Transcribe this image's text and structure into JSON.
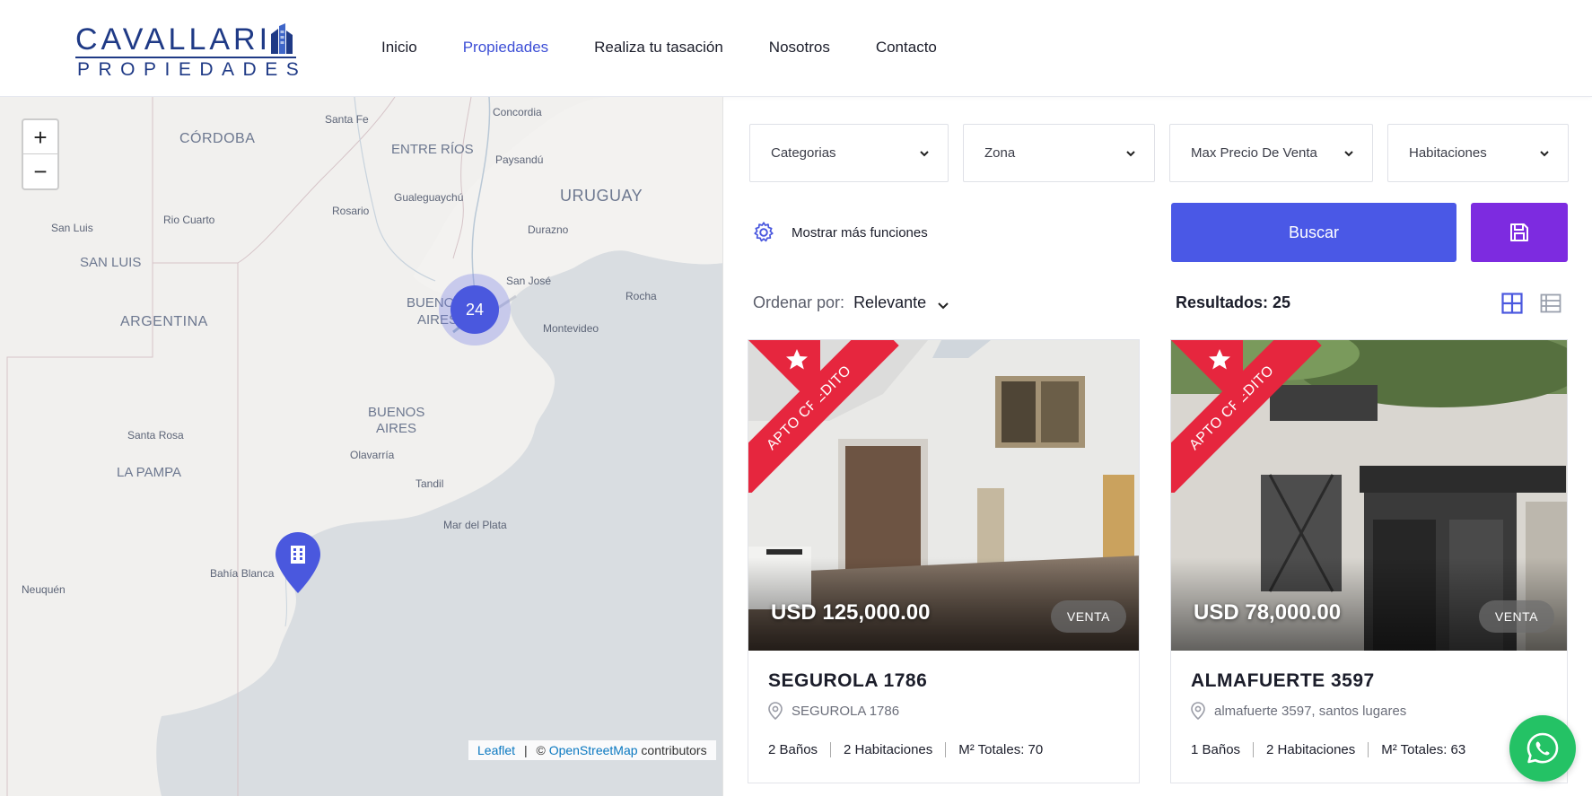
{
  "brand": {
    "logo_top": "CAVALLARI",
    "logo_bottom": "PROPIEDADES",
    "color": "#1f3a86"
  },
  "nav": {
    "items": [
      "Inicio",
      "Propiedades",
      "Realiza tu tasación",
      "Nosotros",
      "Contacto"
    ],
    "active": "Propiedades"
  },
  "map": {
    "zoom_in": "+",
    "zoom_out": "−",
    "cluster_count": "24",
    "labels": {
      "cordoba": "CÓRDOBA",
      "entre_rios": "ENTRE RÍOS",
      "uruguay": "URUGUAY",
      "san_luis_prov": "SAN LUIS",
      "argentina": "ARGENTINA",
      "buenos_aires_city_1": "BUENO",
      "buenos_aires_city_2": "AIRES",
      "buenos_aires_prov_1": "BUENOS",
      "buenos_aires_prov_2": "AIRES",
      "la_pampa": "LA PAMPA",
      "santa_fe": "Santa Fe",
      "concordia": "Concordia",
      "paysandu": "Paysandú",
      "gualeguaychu": "Gualeguaychú",
      "rosario": "Rosario",
      "san_luis": "San Luis",
      "rio_cuarto": "Rio Cuarto",
      "durazno": "Durazno",
      "san_jose": "San José",
      "rocha": "Rocha",
      "montevideo": "Montevideo",
      "santa_rosa": "Santa Rosa",
      "olavarria": "Olavarría",
      "tandil": "Tandil",
      "mar_del_plata": "Mar del Plata",
      "bahia_blanca": "Bahía Blanca",
      "neuquen": "Neuquén"
    },
    "attribution": {
      "leaflet": "Leaflet",
      "sep": "|",
      "copy": "©",
      "osm": "OpenStreetMap",
      "contributors": "contributors"
    }
  },
  "filters": [
    {
      "label": "Categorias"
    },
    {
      "label": "Zona"
    },
    {
      "label": "Max Precio De Venta"
    },
    {
      "label": "Habitaciones"
    }
  ],
  "more_features": "Mostrar más funciones",
  "search_button": "Buscar",
  "sort": {
    "label": "Ordenar por:",
    "value": "Relevante"
  },
  "results": "Resultados: 25",
  "listings": [
    {
      "ribbon": "APTO CREDITO",
      "price": "USD 125,000.00",
      "operation": "VENTA",
      "title": "SEGUROLA 1786",
      "address": "SEGUROLA 1786",
      "baths": "2 Baños",
      "rooms": "2 Habitaciones",
      "area": "M² Totales: 70"
    },
    {
      "ribbon": "APTO CREDITO",
      "price": "USD 78,000.00",
      "operation": "VENTA",
      "title": "ALMAFUERTE 3597",
      "address": "almafuerte 3597, santos lugares",
      "baths": "1 Baños",
      "rooms": "2 Habitaciones",
      "area": "M² Totales: 63"
    }
  ],
  "colors": {
    "primary": "#4a58e6",
    "save": "#7d2be0",
    "ribbon": "#e6263e",
    "whatsapp": "#24c265",
    "nav_active": "#3d4fd6"
  },
  "icons": [
    "gear-icon",
    "save-icon",
    "grid-view-icon",
    "list-view-icon",
    "star-icon",
    "location-pin-icon",
    "whatsapp-icon",
    "chevron-down-icon",
    "building-icon"
  ]
}
